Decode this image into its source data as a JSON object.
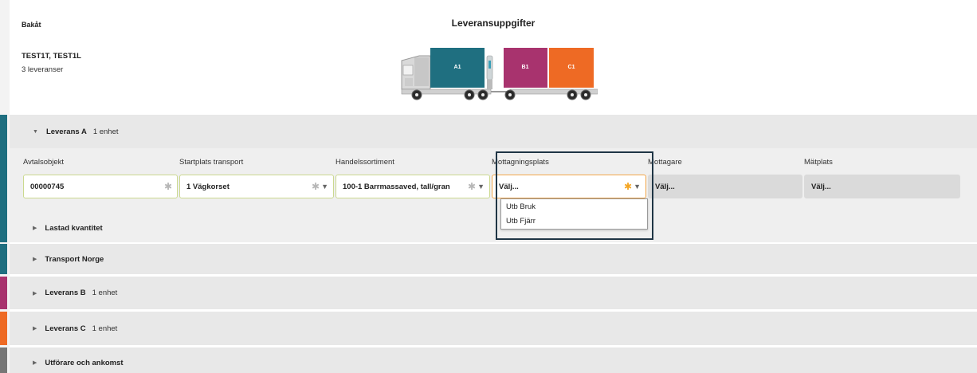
{
  "header": {
    "back_label": "Bakåt",
    "title": "Leveransuppgifter",
    "vehicle_ids": "TEST1T, TEST1L",
    "delivery_count": "3 leveranser"
  },
  "truck": {
    "containers": [
      {
        "label": "A1",
        "color": "#1f6f80"
      },
      {
        "label": "B1",
        "color": "#a8336e"
      },
      {
        "label": "C1",
        "color": "#ee6a24"
      }
    ]
  },
  "sections": [
    {
      "title": "Leverans A",
      "subtitle": "1 enhet",
      "color": "#1f6f80",
      "expanded": true
    },
    {
      "title": "Lastad kvantitet",
      "subtitle": "",
      "color": "#1f6f80",
      "expanded": false
    },
    {
      "title": "Transport Norge",
      "subtitle": "",
      "color": "#1f6f80",
      "expanded": false
    },
    {
      "title": "Leverans B",
      "subtitle": "1 enhet",
      "color": "#a8336e",
      "expanded": false
    },
    {
      "title": "Leverans C",
      "subtitle": "1 enhet",
      "color": "#ee6a24",
      "expanded": false
    },
    {
      "title": "Utförare och ankomst",
      "subtitle": "",
      "color": "#777777",
      "expanded": false
    }
  ],
  "fields": [
    {
      "label": "Avtalsobjekt",
      "value": "00000745"
    },
    {
      "label": "Startplats transport",
      "value": "1 Vägkorset"
    },
    {
      "label": "Handelssortiment",
      "value": "100-1 Barrmassaved, tall/gran"
    },
    {
      "label": "Mottagningsplats",
      "value": "Välj..."
    },
    {
      "label": "Mottagare",
      "value": "Välj..."
    },
    {
      "label": "Mätplats",
      "value": "Välj..."
    }
  ],
  "dropdown": {
    "options": [
      "Utb Bruk",
      "Utb Fjärr"
    ]
  },
  "icons": {
    "required": "asterisk-icon",
    "expand": "caret-down-icon",
    "collapsed": "triangle-right-icon"
  }
}
